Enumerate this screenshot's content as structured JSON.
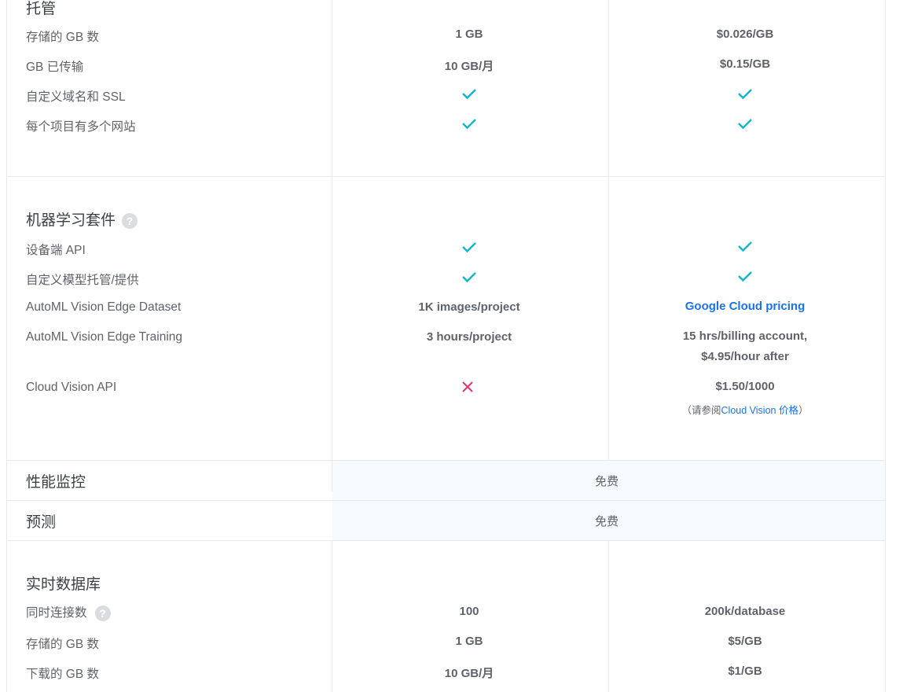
{
  "hosting": {
    "title": "托管",
    "rows": [
      {
        "label": "存储的 GB 数",
        "spark": "1 GB",
        "blaze": "$0.026/GB"
      },
      {
        "label": "GB 已传输",
        "spark": "10 GB/月",
        "blaze": "$0.15/GB"
      },
      {
        "label": "自定义域名和 SSL",
        "spark": "check",
        "blaze": "check"
      },
      {
        "label": "每个项目有多个网站",
        "spark": "check",
        "blaze": "check"
      }
    ]
  },
  "ml": {
    "title": "机器学习套件",
    "help_icon": "?",
    "rows": [
      {
        "label": "设备端 API",
        "spark": "check",
        "blaze": "check"
      },
      {
        "label": "自定义模型托管/提供",
        "spark": "check",
        "blaze": "check"
      },
      {
        "label": "AutoML Vision Edge Dataset",
        "spark": "1K images/project",
        "blaze": "Google Cloud pricing"
      },
      {
        "label": "AutoML Vision Edge Training",
        "spark": "3 hours/project",
        "blaze": "15 hrs/billing account, $4.95/hour after"
      },
      {
        "label": "Cloud Vision API",
        "spark": "cross",
        "blaze": "$1.50/1000"
      }
    ],
    "cloud_vision_note_prefix": "（请参阅",
    "cloud_vision_note_link": "Cloud Vision 价格",
    "cloud_vision_note_suffix": "）"
  },
  "performance": {
    "title": "性能监控",
    "value": "免费"
  },
  "predictions": {
    "title": "预测",
    "value": "免费"
  },
  "realtime_db": {
    "title": "实时数据库",
    "help_icon": "?",
    "rows": [
      {
        "label": "同时连接数",
        "spark": "100",
        "blaze": "200k/database"
      },
      {
        "label": "存储的 GB 数",
        "spark": "1 GB",
        "blaze": "$5/GB"
      },
      {
        "label": "下载的 GB 数",
        "spark": "10 GB/月",
        "blaze": "$1/GB"
      }
    ]
  },
  "icons": {
    "check": "checkmark-icon",
    "cross": "cross-icon",
    "help": "help-icon"
  },
  "colors": {
    "check": "#12b5cb",
    "cross": "#e8336b",
    "link": "#1a73e8",
    "shade": "#f6fafc"
  }
}
